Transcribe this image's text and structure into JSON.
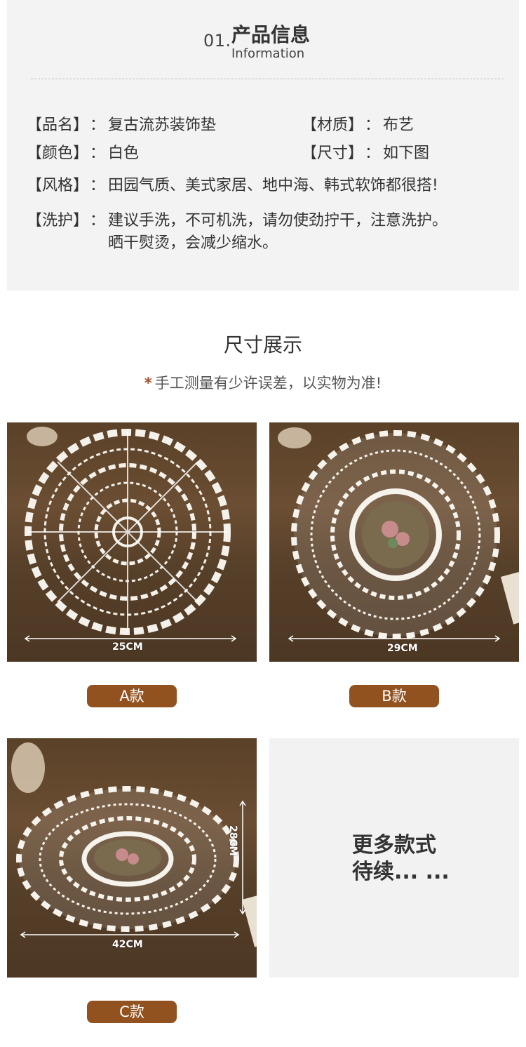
{
  "info": {
    "number": "01.",
    "title": "产品信息",
    "subtitle": "Information",
    "colon": "：",
    "rows": {
      "name": {
        "label": "【品名】",
        "value": "复古流苏装饰垫"
      },
      "material": {
        "label": "【材质】",
        "value": "布艺"
      },
      "color": {
        "label": "【颜色】",
        "value": "白色"
      },
      "size": {
        "label": "【尺寸】",
        "value": "如下图"
      },
      "style": {
        "label": "【风格】",
        "value": "田园气质、美式家居、地中海、韩式软饰都很搭!"
      },
      "care": {
        "label": "【洗护】",
        "value_line1": "建议手洗，不可机洗，请勿使劲拧干，注意洗护。",
        "value_line2": "晒干熨烫，会减少缩水。"
      }
    }
  },
  "size_section": {
    "title": "尺寸展示",
    "note_star": "*",
    "note": "手工测量有少许误差，以实物为准!"
  },
  "products": [
    {
      "label": "A款",
      "width_text": "25CM"
    },
    {
      "label": "B款",
      "width_text": "29CM"
    },
    {
      "label": "C款",
      "width_text": "42CM",
      "height_text": "28CM"
    }
  ],
  "more": {
    "text": "更多款式\n待续... ..."
  },
  "colors": {
    "accent": "#91521f",
    "wood": "#5a4128",
    "panel": "#f3f3f3"
  }
}
